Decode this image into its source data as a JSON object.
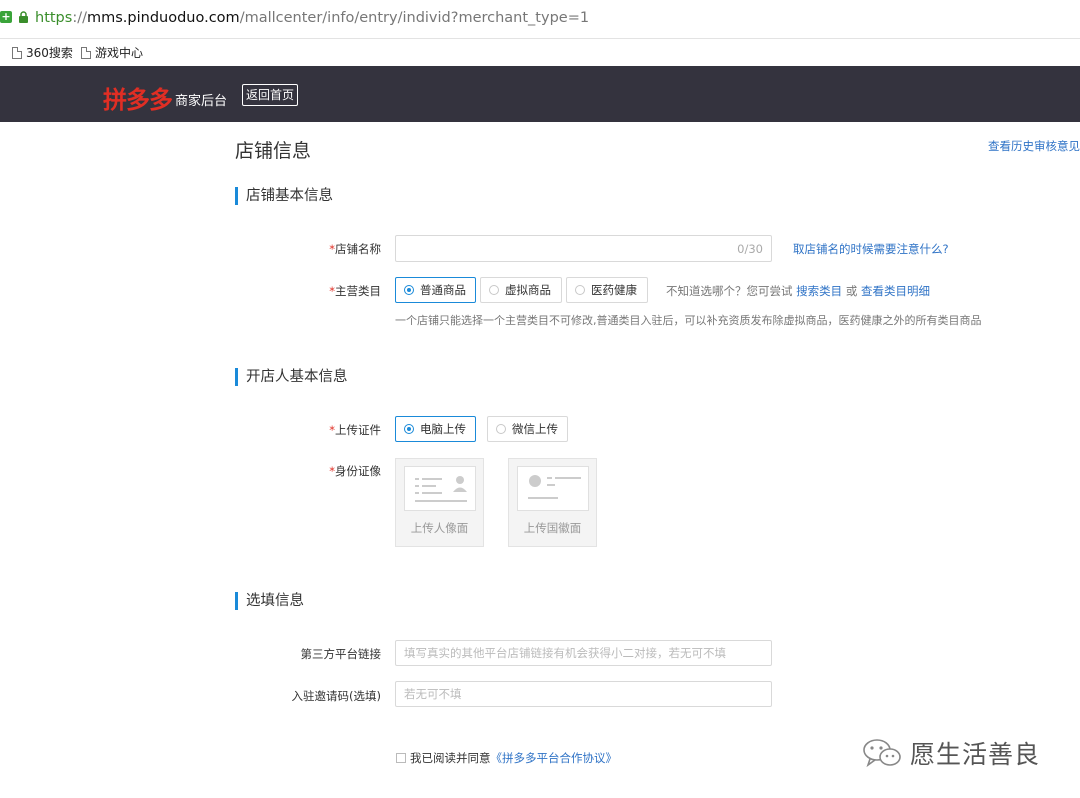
{
  "browser": {
    "url_scheme": "https",
    "url_sep": "://",
    "url_host": "mms.pinduoduo.com",
    "url_path": "/mallcenter/info/entry/individ?merchant_type=1",
    "bookmarks": [
      {
        "label": "360搜索"
      },
      {
        "label": "游戏中心"
      }
    ]
  },
  "header": {
    "logo": "拼多多",
    "subtitle": "商家后台",
    "home_button": "返回首页"
  },
  "page": {
    "title": "店铺信息",
    "history_link": "查看历史审核意见"
  },
  "sections": {
    "basic": "店铺基本信息",
    "owner": "开店人基本信息",
    "optional": "选填信息"
  },
  "form": {
    "required_mark": "*",
    "shop_name": {
      "label": "店铺名称",
      "counter": "0/30",
      "tip_link": "取店铺名的时候需要注意什么?"
    },
    "category": {
      "label": "主营类目",
      "options": [
        "普通商品",
        "虚拟商品",
        "医药健康"
      ],
      "selected_index": 0,
      "hint_prefix": "不知道选哪个？您可尝试",
      "hint_link1": "搜索类目",
      "hint_or": "或",
      "hint_link2": "查看类目明细",
      "note": "一个店铺只能选择一个主营类目不可修改,普通类目入驻后，可以补充资质发布除虚拟商品，医药健康之外的所有类目商品"
    },
    "upload_method": {
      "label": "上传证件",
      "options": [
        "电脑上传",
        "微信上传"
      ],
      "selected_index": 0
    },
    "id_card": {
      "label": "身份证像",
      "front": "上传人像面",
      "back": "上传国徽面"
    },
    "third_party": {
      "label": "第三方平台链接",
      "placeholder": "填写真实的其他平台店铺链接有机会获得小二对接，若无可不填"
    },
    "invite_code": {
      "label": "入驻邀请码(选填)",
      "placeholder": "若无可不填"
    },
    "agreement": {
      "prefix": "我已阅读并同意",
      "link": "《拼多多平台合作协议》"
    }
  },
  "watermark": {
    "text": "愿生活善良"
  },
  "colors": {
    "brand_red": "#e02e24",
    "accent_blue": "#1a8ad9",
    "link_blue": "#2f73c6",
    "header_bg": "#34333e"
  }
}
